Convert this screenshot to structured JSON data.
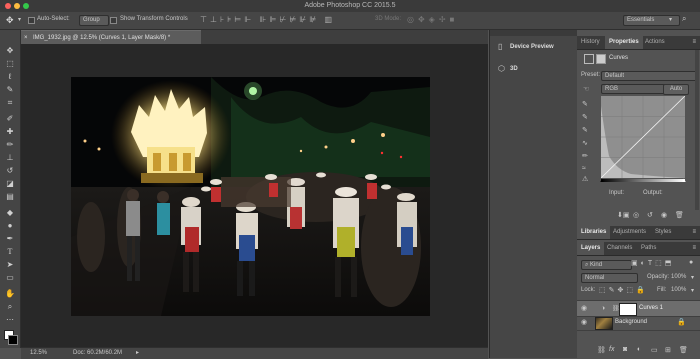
{
  "window": {
    "title": "Adobe Photoshop CC 2015.5"
  },
  "options_bar": {
    "auto_select_label": "Auto-Select:",
    "auto_select_value": "Group",
    "show_transform_label": "Show Transform Controls",
    "mode_3d_label": "3D Mode:",
    "workspace_value": "Essentials"
  },
  "document": {
    "tab_label": "IMG_1932.jpg @ 12.5% (Curves 1, Layer Mask/8) *",
    "zoom": "12.5%",
    "doc_info": "Doc: 60.2M/60.2M"
  },
  "mid_panel": {
    "device_preview_label": "Device Preview",
    "three_d_label": "3D"
  },
  "properties_panel": {
    "tabs": [
      "History",
      "Properties",
      "Actions"
    ],
    "active_tab": "Properties",
    "adjustment_name": "Curves",
    "preset_label": "Preset:",
    "preset_value": "Default",
    "channel_value": "RGB",
    "auto_label": "Auto",
    "input_label": "Input:",
    "output_label": "Output:"
  },
  "libraries_panel": {
    "tabs": [
      "Libraries",
      "Adjustments",
      "Styles"
    ],
    "active_tab": "Libraries"
  },
  "layers_panel": {
    "tabs": [
      "Layers",
      "Channels",
      "Paths"
    ],
    "active_tab": "Layers",
    "kind_label": "Kind",
    "blend_mode": "Normal",
    "opacity_label": "Opacity:",
    "opacity_value": "100%",
    "lock_label": "Lock:",
    "fill_label": "Fill:",
    "fill_value": "100%",
    "layers": [
      {
        "name": "Curves 1",
        "selected": true
      },
      {
        "name": "Background",
        "selected": false
      }
    ]
  },
  "colors": {
    "accent_selected": "#6d6d6d",
    "window_close": "#fc615d",
    "window_min": "#fdbc40",
    "window_max": "#34c84a"
  }
}
